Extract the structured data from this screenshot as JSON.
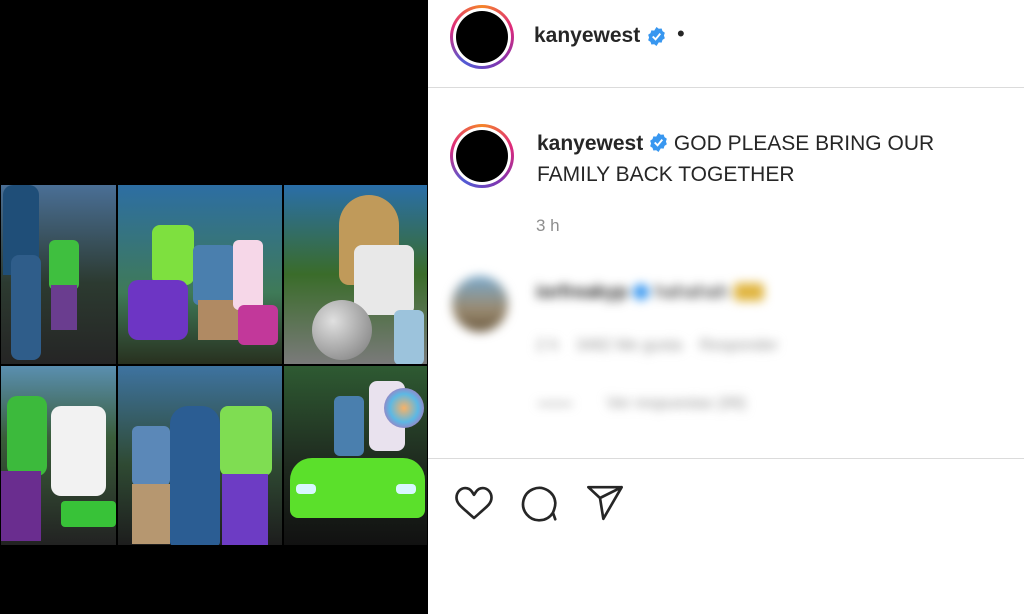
{
  "post": {
    "username": "kanyewest",
    "header_dot": "•",
    "caption_user": "kanyewest",
    "caption_text": "GOD PLEASE BRING OUR FAMILY BACK TOGETHER",
    "time": "3 h"
  },
  "comment": {
    "username": "iorfreakyp",
    "text": "hahahah",
    "likes_reply": "2 h    3482 Me gusta    Responder",
    "view_replies": "Ver respuestas (99)"
  },
  "actions": {
    "like_icon": "heart-icon",
    "comment_icon": "comment-icon",
    "share_icon": "share-icon"
  },
  "colors": {
    "verified": "#3897f0",
    "text": "#262626",
    "muted": "#8e8e8e",
    "car_green": "#5be02b"
  }
}
